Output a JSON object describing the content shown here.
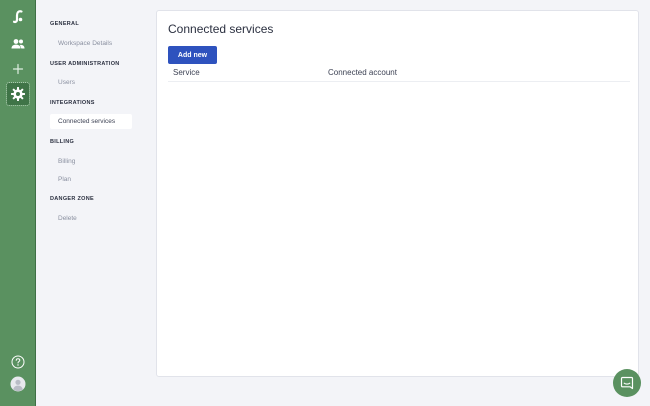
{
  "nav": {
    "sections": [
      {
        "heading": "GENERAL",
        "items": [
          "Workspace Details"
        ]
      },
      {
        "heading": "USER ADMINISTRATION",
        "items": [
          "Users"
        ]
      },
      {
        "heading": "INTEGRATIONS",
        "items": [
          "Connected services"
        ]
      },
      {
        "heading": "BILLING",
        "items": [
          "Billing",
          "Plan"
        ]
      },
      {
        "heading": "DANGER ZONE",
        "items": [
          "Delete"
        ]
      }
    ],
    "active_item": "Connected services"
  },
  "main": {
    "title": "Connected services",
    "add_button": "Add new",
    "columns": [
      "Service",
      "Connected account"
    ]
  },
  "rail": {
    "icons": [
      "logo-icon",
      "users-icon",
      "plus-icon",
      "gear-icon",
      "help-icon",
      "avatar-icon"
    ],
    "active": "gear-icon"
  },
  "colors": {
    "rail": "#5a9160",
    "accent": "#2e52be",
    "background": "#f3f4f8"
  }
}
